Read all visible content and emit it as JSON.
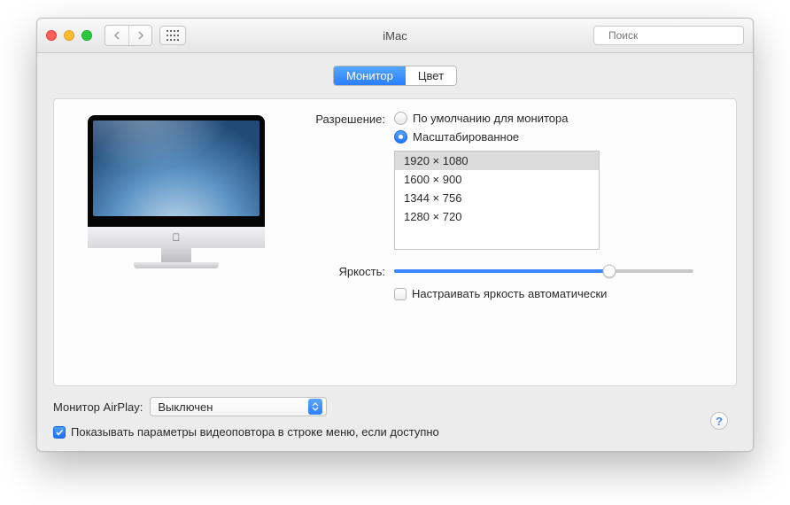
{
  "window": {
    "title": "iMac",
    "search_placeholder": "Поиск"
  },
  "tabs": {
    "monitor": "Монитор",
    "color": "Цвет"
  },
  "resolution": {
    "label": "Разрешение:",
    "default_option": "По умолчанию для монитора",
    "scaled_option": "Масштабированное",
    "list": {
      "0": "1920 × 1080",
      "1": "1600 × 900",
      "2": "1344 × 756",
      "3": "1280 × 720"
    }
  },
  "brightness": {
    "label": "Яркость:",
    "auto_label": "Настраивать яркость автоматически"
  },
  "airplay": {
    "label": "Монитор AirPlay:",
    "value": "Выключен"
  },
  "mirroring_checkbox": "Показывать параметры видеоповтора в строке меню, если доступно"
}
